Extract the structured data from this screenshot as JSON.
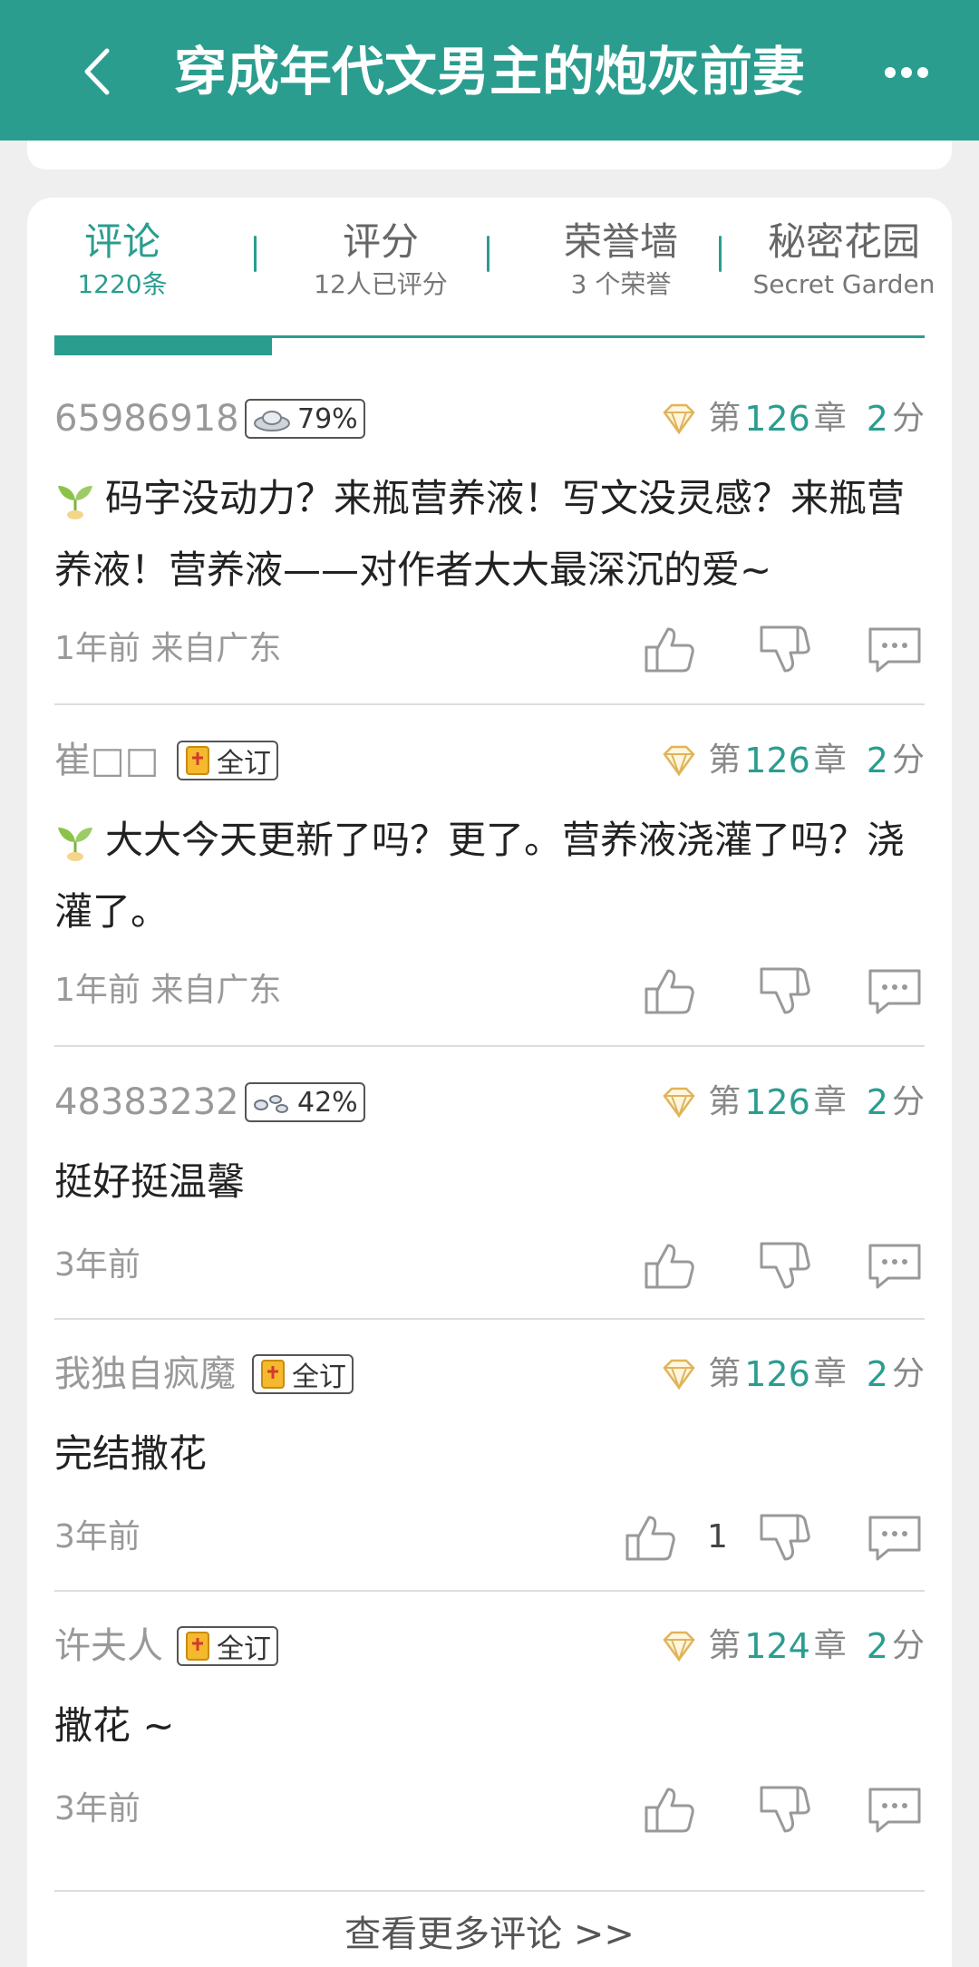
{
  "header": {
    "title": "穿成年代文男主的炮灰前妻",
    "back_icon": "chevron-left-icon",
    "more_icon": "more-dots-icon",
    "color": "#2a9d8f"
  },
  "tabs": [
    {
      "label": "评论",
      "sub": "1220条",
      "active": true
    },
    {
      "label": "评分",
      "sub": "12人已评分",
      "active": false
    },
    {
      "label": "荣誉墙",
      "sub": "3 个荣誉",
      "active": false
    },
    {
      "label": "秘密花园",
      "sub": "Secret Garden",
      "active": false
    }
  ],
  "comments": [
    {
      "user": "65986918",
      "badge": {
        "icon": "silver-ingot-icon",
        "text": "79%"
      },
      "chapter_prefix": "第",
      "chapter_num": "126",
      "chapter_suffix": "章",
      "score_num": "2",
      "score_unit": "分",
      "has_sprout": true,
      "text": "码字没动力？来瓶营养液！写文没灵感？来瓶营养液！营养液——对作者大大最深沉的爱~",
      "time": "1年前  来自广东",
      "likes": ""
    },
    {
      "user": "崔□□",
      "badge": {
        "icon": "full-subscription-icon",
        "text": "全订"
      },
      "chapter_prefix": "第",
      "chapter_num": "126",
      "chapter_suffix": "章",
      "score_num": "2",
      "score_unit": "分",
      "has_sprout": true,
      "text": "大大今天更新了吗？更了。营养液浇灌了吗？浇灌了。",
      "time": "1年前  来自广东",
      "likes": ""
    },
    {
      "user": "48383232",
      "badge": {
        "icon": "pebbles-icon",
        "text": "42%"
      },
      "chapter_prefix": "第",
      "chapter_num": "126",
      "chapter_suffix": "章",
      "score_num": "2",
      "score_unit": "分",
      "has_sprout": false,
      "text": "挺好挺温馨",
      "time": "3年前",
      "likes": ""
    },
    {
      "user": "我独自疯魔",
      "badge": {
        "icon": "full-subscription-icon",
        "text": "全订"
      },
      "chapter_prefix": "第",
      "chapter_num": "126",
      "chapter_suffix": "章",
      "score_num": "2",
      "score_unit": "分",
      "has_sprout": false,
      "text": "完结撒花",
      "time": "3年前",
      "likes": "1"
    },
    {
      "user": "许夫人",
      "badge": {
        "icon": "full-subscription-icon",
        "text": "全订"
      },
      "chapter_prefix": "第",
      "chapter_num": "124",
      "chapter_suffix": "章",
      "score_num": "2",
      "score_unit": "分",
      "has_sprout": false,
      "text": "撒花 ~",
      "time": "3年前",
      "likes": ""
    }
  ],
  "more_comments": "查看更多评论 >>"
}
